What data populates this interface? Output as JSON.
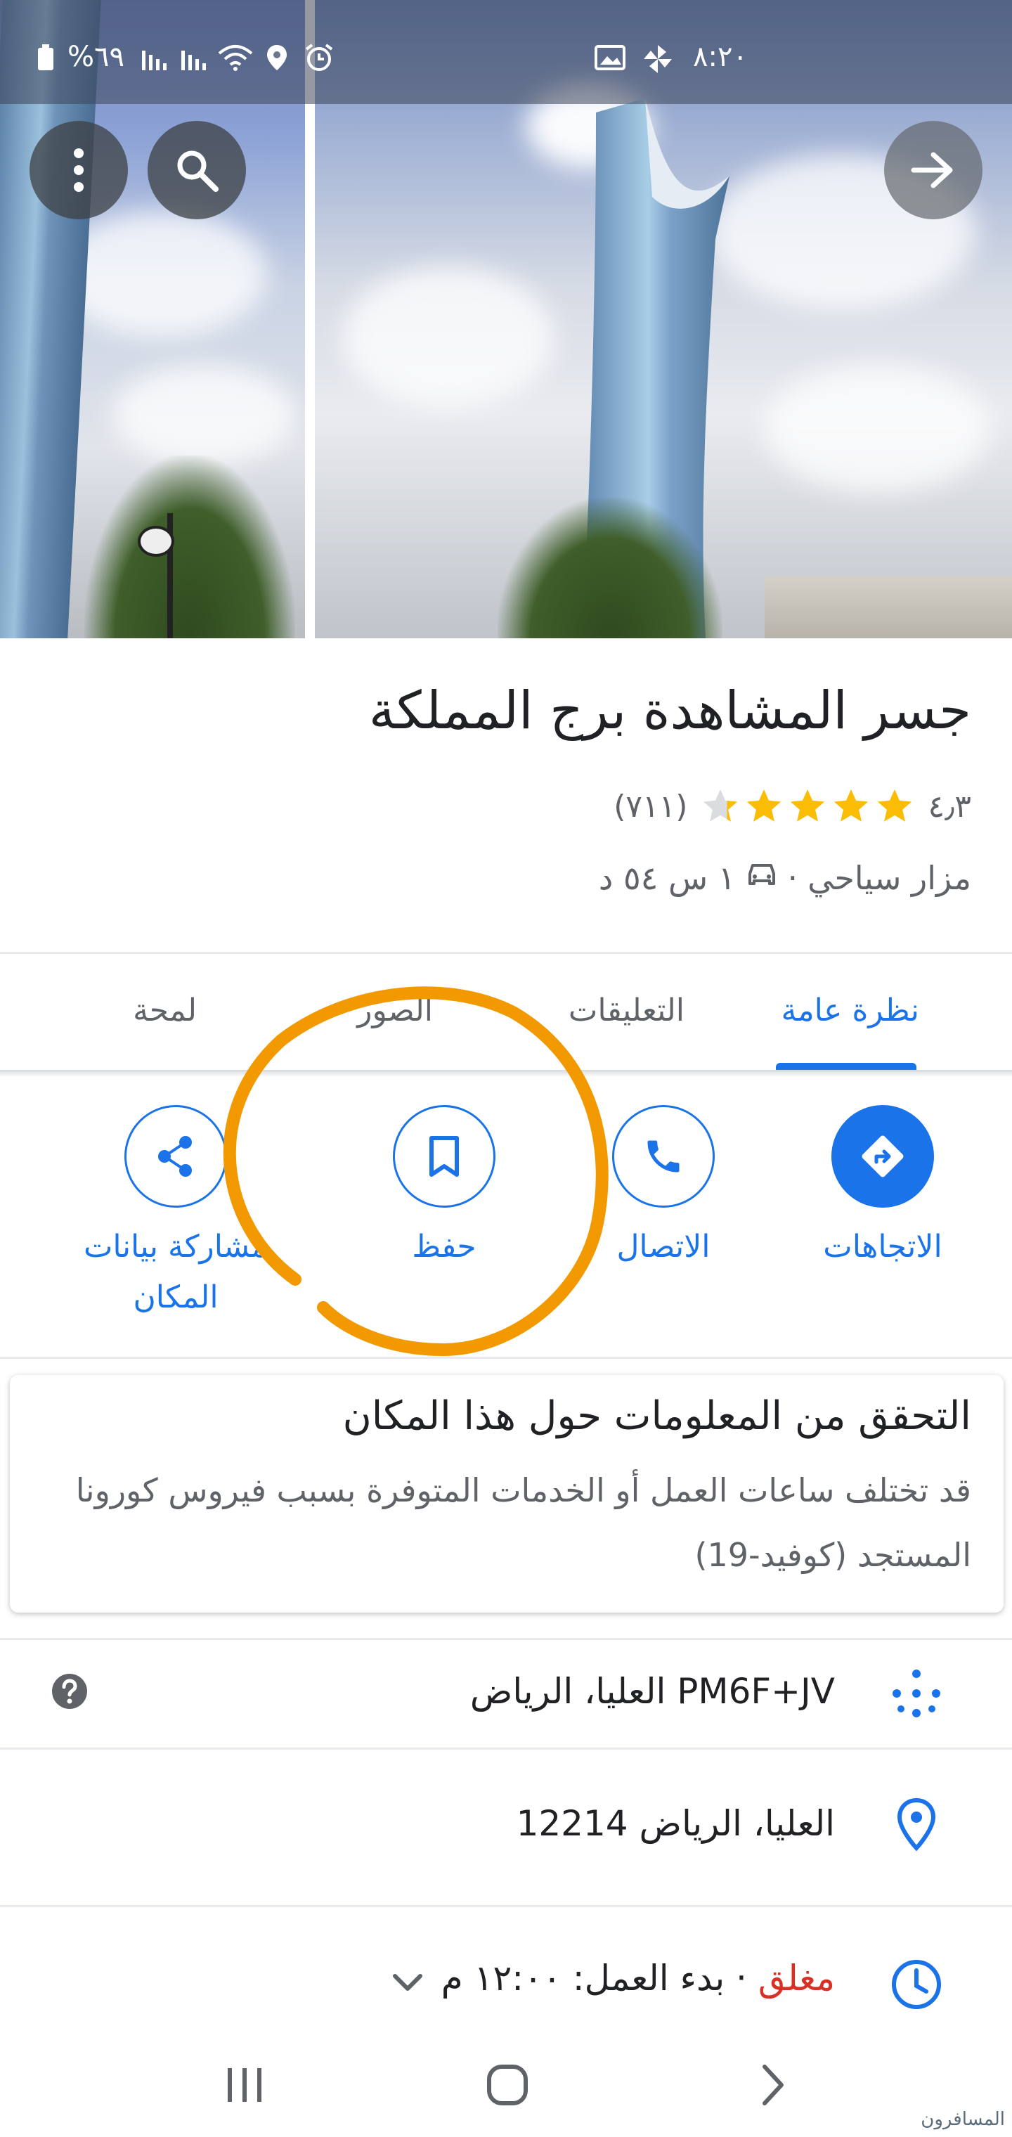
{
  "status_bar": {
    "time": "٨:٢٠",
    "battery": "%٦٩"
  },
  "place": {
    "title": "جسر المشاهدة برج المملكة",
    "rating": "٤٫٣",
    "stars_filled": 4.3,
    "reviews": "(٧١١)",
    "category": "مزار سياحي",
    "separator": "·",
    "drive_time": "١ س ٥٤ د"
  },
  "tabs": [
    {
      "label": "نظرة عامة",
      "active": true
    },
    {
      "label": "التعليقات",
      "active": false
    },
    {
      "label": "الصور",
      "active": false
    },
    {
      "label": "لمحة",
      "active": false
    }
  ],
  "actions": [
    {
      "label": "الاتجاهات",
      "icon": "directions-icon"
    },
    {
      "label": "الاتصال",
      "icon": "phone-icon"
    },
    {
      "label": "حفظ",
      "icon": "bookmark-icon"
    },
    {
      "label": "مشاركة بيانات المكان",
      "icon": "share-icon"
    }
  ],
  "covid": {
    "title": "التحقق من المعلومات حول هذا المكان",
    "body": "قد تختلف ساعات العمل أو الخدمات المتوفرة بسبب فيروس كورونا المستجد (كوفيد-19)"
  },
  "info": {
    "plus_code": "PM6F+JV العليا، الرياض",
    "address": "العليا، الرياض 12214",
    "hours_status": "مغلق",
    "hours_detail": " · بدء العمل: ١٢:٠٠ م"
  },
  "watermark": "المسافرون",
  "colors": {
    "accent": "#1a73e8",
    "star": "#fbbc04",
    "closed": "#d93025",
    "annotation": "#f29900"
  }
}
